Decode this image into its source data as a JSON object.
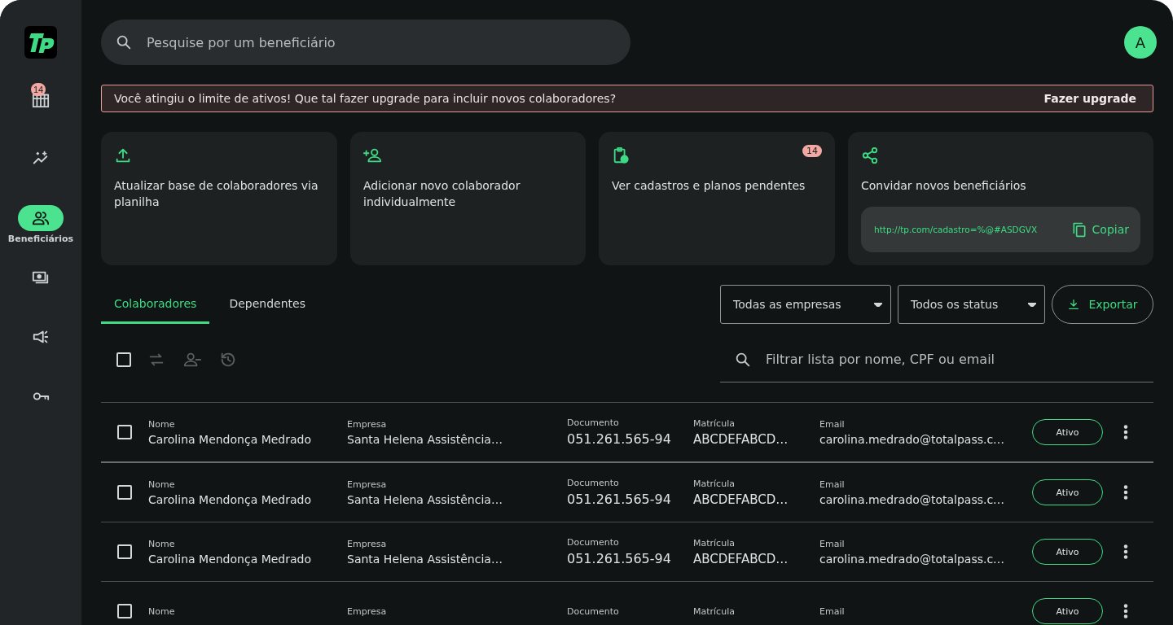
{
  "sidebar": {
    "items": [
      {
        "badge": "14",
        "selected": false
      },
      {
        "selected": false
      },
      {
        "label": "Beneficiários",
        "selected": true
      },
      {
        "selected": false
      },
      {
        "selected": false
      },
      {
        "selected": false
      }
    ]
  },
  "search": {
    "placeholder": "Pesquise por um beneficiário"
  },
  "avatar": "A",
  "alert": {
    "message": "Você atingiu o limite de ativos! Que tal fazer upgrade para incluir novos colaboradores?",
    "action": "Fazer upgrade"
  },
  "cards": [
    {
      "title": "Atualizar base de colaboradores via planilha"
    },
    {
      "title": "Adicionar novo colaborador individualmente"
    },
    {
      "title": "Ver cadastros e planos pendentes",
      "badge": "14"
    },
    {
      "title": "Convidar novos beneficiários",
      "link": "http://tp.com/cadastro=%@#ASDGVX",
      "copy": "Copiar"
    }
  ],
  "tabs": [
    {
      "label": "Colaboradores",
      "selected": true
    },
    {
      "label": "Dependentes",
      "selected": false
    }
  ],
  "filters": [
    "Todas as empresas",
    "Todos os status"
  ],
  "export": "Exportar",
  "toolbar": {
    "select_all": false,
    "actions_disabled": true
  },
  "filter_search": {
    "placeholder": "Filtrar lista por nome, CPF ou email"
  },
  "rows": [
    {
      "checked": false,
      "fields": [
        {
          "label": "Nome",
          "value": "Carolina Mendonça Medrado"
        },
        {
          "label": "Empresa",
          "value": "Santa Helena Assistência…"
        },
        {
          "label": "Documento",
          "value": "051.261.565-94"
        },
        {
          "label": "Matrícula",
          "value": "ABCDEFABCD…"
        },
        {
          "label": "Email",
          "value": "carolina.medrado@totalpass.c…"
        }
      ],
      "status": "Ativo"
    },
    {
      "checked": false,
      "fields": [
        {
          "label": "Nome",
          "value": "Carolina Mendonça Medrado"
        },
        {
          "label": "Empresa",
          "value": "Santa Helena Assistência…"
        },
        {
          "label": "Documento",
          "value": "051.261.565-94"
        },
        {
          "label": "Matrícula",
          "value": "ABCDEFABCD…"
        },
        {
          "label": "Email",
          "value": "carolina.medrado@totalpass.c…"
        }
      ],
      "status": "Ativo"
    },
    {
      "checked": false,
      "fields": [
        {
          "label": "Nome",
          "value": "Carolina Mendonça Medrado"
        },
        {
          "label": "Empresa",
          "value": "Santa Helena Assistência…"
        },
        {
          "label": "Documento",
          "value": "051.261.565-94"
        },
        {
          "label": "Matrícula",
          "value": "ABCDEFABCD…"
        },
        {
          "label": "Email",
          "value": "carolina.medrado@totalpass.c…"
        }
      ],
      "status": "Ativo"
    },
    {
      "checked": false,
      "fields": [
        {
          "label": "Nome"
        },
        {
          "label": "Empresa"
        },
        {
          "label": "Documento"
        },
        {
          "label": "Matrícula"
        },
        {
          "label": "Email"
        }
      ],
      "status": "Ativo"
    }
  ]
}
